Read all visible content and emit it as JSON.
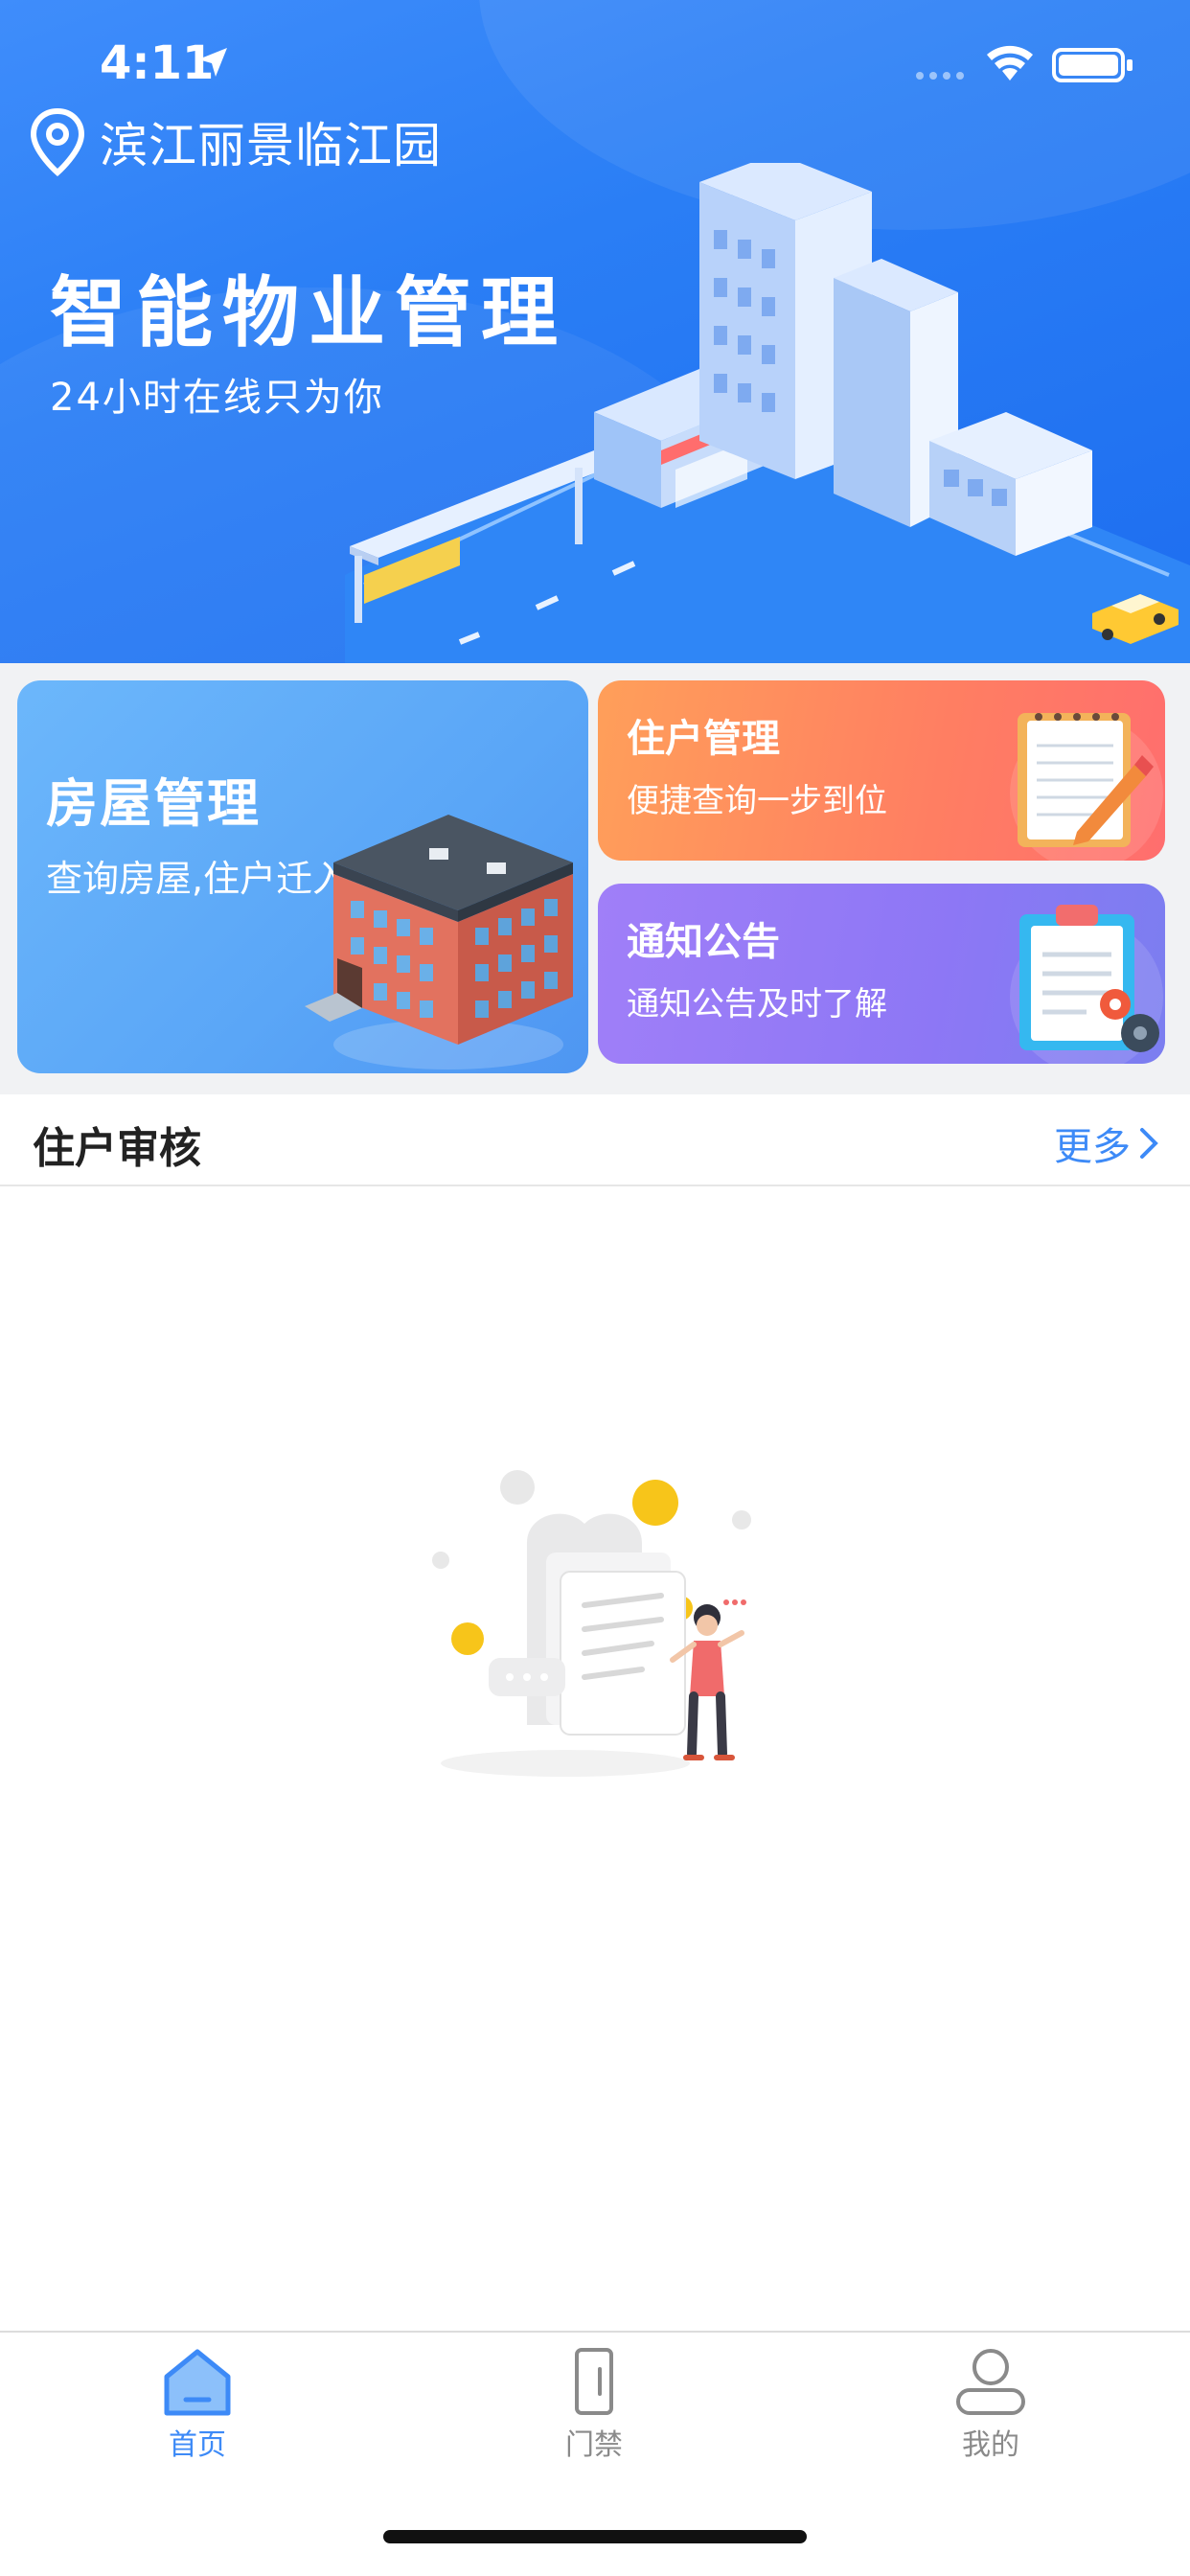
{
  "status_bar": {
    "time": "4:11"
  },
  "header": {
    "location": "滨江丽景临江园",
    "title": "智能物业管理",
    "subtitle": "24小时在线只为你"
  },
  "cards": {
    "house": {
      "title": "房屋管理",
      "subtitle": "查询房屋,住户迁入"
    },
    "resident": {
      "title": "住户管理",
      "subtitle": "便捷查询一步到位"
    },
    "notice": {
      "title": "通知公告",
      "subtitle": "通知公告及时了解"
    }
  },
  "section": {
    "title": "住户审核",
    "more": "更多"
  },
  "tabbar": {
    "items": [
      {
        "label": "首页",
        "icon": "home-icon",
        "active": true
      },
      {
        "label": "门禁",
        "icon": "door-icon",
        "active": false
      },
      {
        "label": "我的",
        "icon": "person-icon",
        "active": false
      }
    ]
  },
  "colors": {
    "primary": "#3d8af7",
    "hero_bg": "#2a7ef5",
    "resident_card": "#ff7e62",
    "notice_card": "#8d77f5",
    "house_card": "#5aa6f7"
  }
}
